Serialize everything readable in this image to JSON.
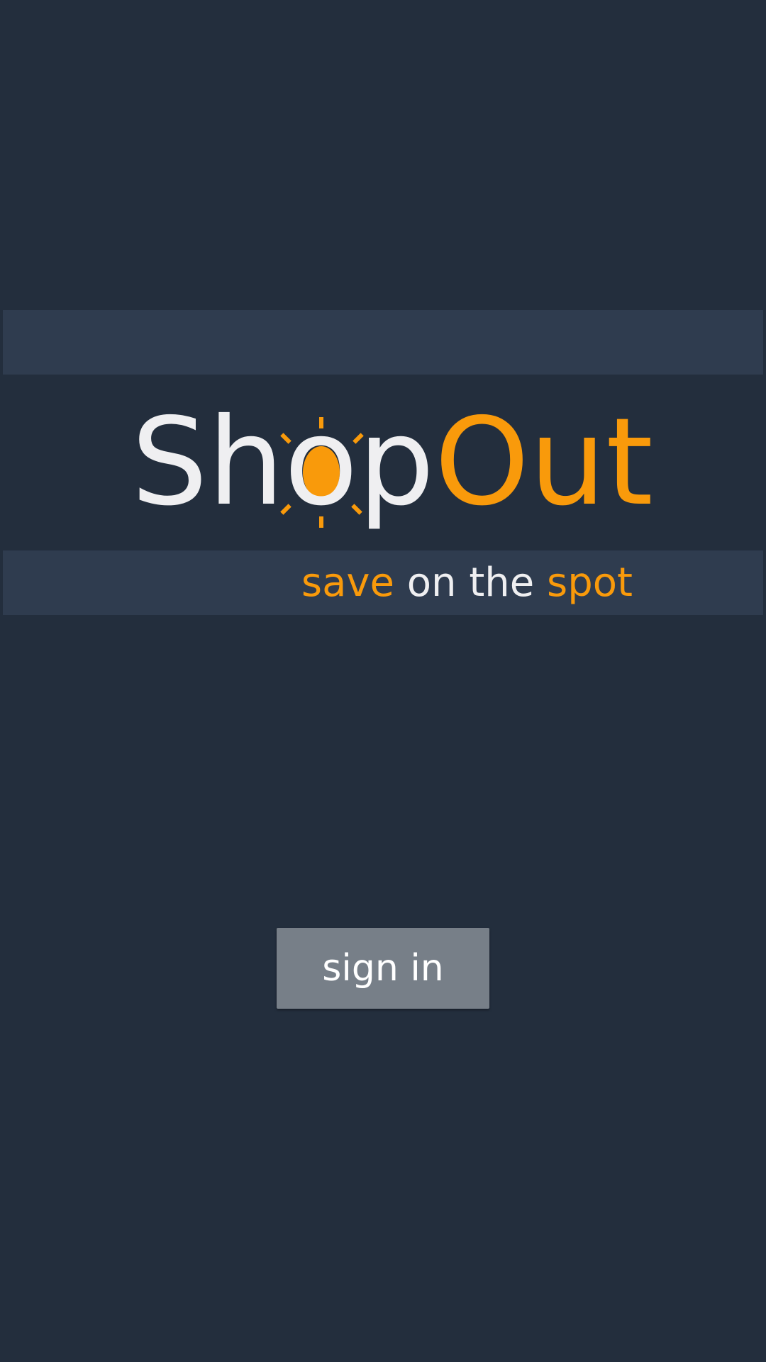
{
  "app": {
    "logo": {
      "part1": "Sh",
      "accent_letter": "o",
      "part2": "p",
      "part3": "Out"
    },
    "tagline": {
      "word1": "save",
      "word2": " on the ",
      "word3": "spot"
    },
    "signin_label": "sign in"
  },
  "colors": {
    "background": "#232e3d",
    "band": "#2f3c4f",
    "accent": "#f99a0b",
    "text": "#efeff1",
    "button": "#777f88"
  },
  "icons": {
    "logo_mark": "sun-burst-icon"
  }
}
